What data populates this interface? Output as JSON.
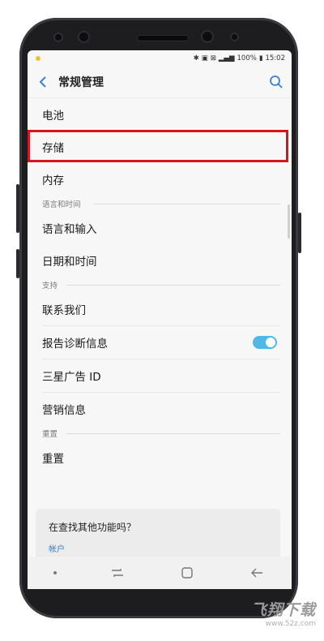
{
  "status": {
    "battery": "100%",
    "time": "15:02"
  },
  "appbar": {
    "title": "常规管理",
    "back_icon": "chevron-left-icon",
    "search_icon": "search-icon"
  },
  "menu": {
    "battery": "电池",
    "storage": "存储",
    "memory": "内存",
    "section_lang": "语言和时间",
    "lang_input": "语言和输入",
    "date_time": "日期和时间",
    "section_support": "支持",
    "contact": "联系我们",
    "report": "报告诊断信息",
    "report_toggle_on": true,
    "ad_id": "三星广告 ID",
    "marketing": "营销信息",
    "section_reset": "重置",
    "reset": "重置"
  },
  "card": {
    "title": "在查找其他功能吗？",
    "link": "帐户"
  },
  "watermark": {
    "main": "飞翔下载",
    "sub": "www.52z.com"
  },
  "colors": {
    "highlight": "#d9151b",
    "accent": "#4fb8e6",
    "link": "#2f7fd6"
  }
}
